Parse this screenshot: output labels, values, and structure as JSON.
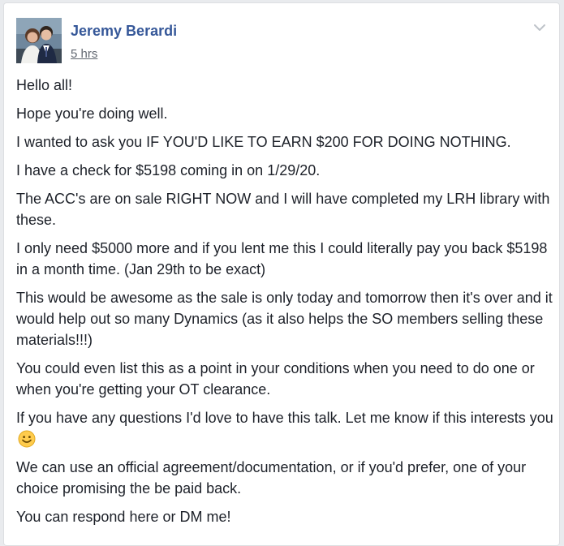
{
  "post": {
    "author_name": "Jeremy Berardi",
    "timestamp": "5 hrs",
    "avatar_icon": "profile-photo",
    "options_icon": "chevron-down-icon",
    "paragraphs": [
      "Hello all!",
      "Hope you're doing well.",
      "I wanted to ask you IF YOU'D LIKE TO EARN $200 FOR DOING NOTHING.",
      "I have a check for $5198 coming in on 1/29/20.",
      "The ACC's are on sale RIGHT NOW and I will have completed my LRH library with these.",
      "I only need $5000 more and if you lent me this I could literally pay you back $5198 in a month time. (Jan 29th to be exact)",
      "This would be awesome as the sale is only today and tomorrow then it's over and it would help out so many Dynamics (as it also helps the SO members selling these materials!!!)",
      "You could even list this as a point in your conditions when you need to do one or when you're getting your OT clearance.",
      "If you have any questions I'd love to have this talk. Let me know if this interests you",
      "We can use an official agreement/documentation, or if you'd prefer, one of your choice promising the be paid back.",
      "You can respond here or DM me!"
    ],
    "emoji_icon": "smile-emoji-icon"
  },
  "colors": {
    "page_background": "#e9ebee",
    "card_background": "#ffffff",
    "author_link": "#365899",
    "body_text": "#1d2129",
    "meta_text": "#616770"
  }
}
